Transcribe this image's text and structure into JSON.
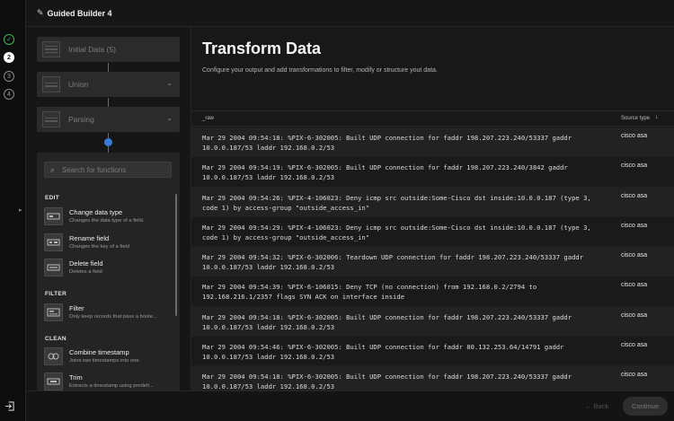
{
  "app": {
    "title": "Guided Builder 4"
  },
  "steps": [
    {
      "label": "✓",
      "state": "done"
    },
    {
      "label": "2",
      "state": "active"
    },
    {
      "label": "3",
      "state": "todo"
    },
    {
      "label": "4",
      "state": "todo"
    }
  ],
  "pipeline": {
    "nodes": [
      {
        "label": "Initial Data (5)",
        "has_dropdown": false
      },
      {
        "label": "Union",
        "has_dropdown": true
      },
      {
        "label": "Parsing",
        "has_dropdown": true
      }
    ]
  },
  "functions": {
    "search_placeholder": "Search for functions",
    "sections": [
      {
        "title": "EDIT"
      },
      {
        "title": "FILTER"
      },
      {
        "title": "CLEAN"
      }
    ],
    "items": [
      {
        "name": "Change data type",
        "desc": "Changes the data type of a field."
      },
      {
        "name": "Rename field",
        "desc": "Changes the key of a field"
      },
      {
        "name": "Delete field",
        "desc": "Deletes a field"
      },
      {
        "name": "Filter",
        "desc": "Only keep records that pass a boole..."
      },
      {
        "name": "Combine timestamp",
        "desc": "Joins two timestamps into one."
      },
      {
        "name": "Trim",
        "desc": "Extracts a timestamp using predefi..."
      }
    ]
  },
  "main": {
    "title": "Transform Data",
    "description": "Configure your output and add transformations to filter, modify or structure yout data.",
    "columns": {
      "raw": "_raw",
      "source_type": "Source type"
    },
    "rows": [
      {
        "raw": "Mar 29 2004 09:54:18: %PIX-6-302005: Built UDP connection for faddr 198.207.223.240/53337 gaddr 10.0.0.187/53 laddr 192.168.0.2/53",
        "source": "cisco asa"
      },
      {
        "raw": "Mar 29 2004 09:54:19: %PIX-6-302005: Built UDP connection for faddr 198.207.223.240/3842 gaddr 10.0.0.187/53 laddr 192.168.0.2/53",
        "source": "cisco asa"
      },
      {
        "raw": "Mar 29 2004 09:54:26: %PIX-4-106023: Deny icmp src outside:Some-Cisco dst inside:10.0.0.187 (type 3, code 1) by access-group \"outside_access_in\"",
        "source": "cisco asa"
      },
      {
        "raw": "Mar 29 2004 09:54:29: %PIX-4-106023: Deny icmp src outside:Some-Cisco dst inside:10.0.0.187 (type 3, code 1) by access-group \"outside_access_in\"",
        "source": "cisco asa"
      },
      {
        "raw": "Mar 29 2004 09:54:32: %PIX-6-302006: Teardown UDP connection for faddr 198.207.223.240/53337 gaddr 10.0.0.187/53 laddr 192.168.0.2/53",
        "source": "cisco asa"
      },
      {
        "raw": "Mar 29 2004 09:54:39: %PIX-6-106015: Deny TCP (no connection) from 192.168.0.2/2794 to 192.168.216.1/2357 flags SYN ACK on interface inside",
        "source": "cisco asa"
      },
      {
        "raw": "Mar 29 2004 09:54:18: %PIX-6-302005: Built UDP connection for faddr 198.207.223.240/53337 gaddr 10.0.0.187/53 laddr 192.168.0.2/53",
        "source": "cisco asa"
      },
      {
        "raw": "Mar 29 2004 09:54:46: %PIX-6-302005: Built UDP connection for faddr 80.132.253.64/14791 gaddr 10.0.0.187/53 laddr 192.168.0.2/53",
        "source": "cisco asa"
      },
      {
        "raw": "Mar 29 2004 09:54:18: %PIX-6-302005: Built UDP connection for faddr 198.207.223.240/53337 gaddr 10.0.0.187/53 laddr 192.168.0.2/53",
        "source": "cisco asa"
      }
    ]
  },
  "footer": {
    "back_label": "Back",
    "continue_label": "Continue"
  },
  "icons": {
    "steps": "step-icon",
    "exit": "exit-icon",
    "search": "search-icon",
    "sort": "arrow-down-icon"
  }
}
